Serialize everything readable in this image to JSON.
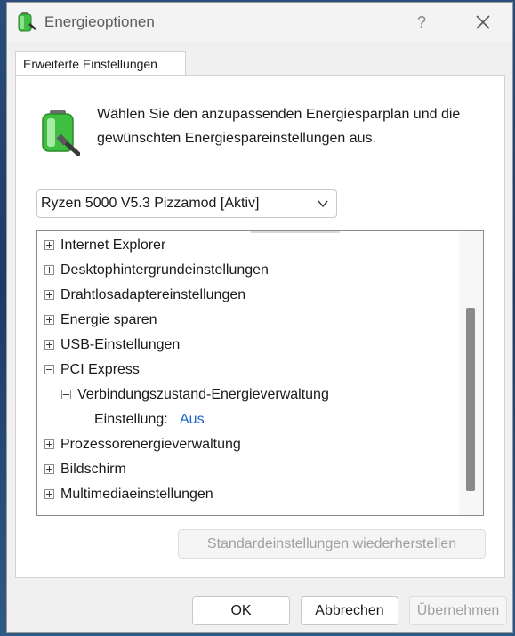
{
  "window": {
    "title": "Energieoptionen",
    "help_glyph": "?",
    "close_icon": "close-icon"
  },
  "tab": {
    "label": "Erweiterte Einstellungen"
  },
  "description": "Wählen Sie den anzupassenden Energiesparplan und die gewünschten Energiespareinstellungen aus.",
  "plan_select": {
    "value": "Ryzen 5000 V5.3 Pizzamod [Aktiv]"
  },
  "tree": {
    "items": [
      {
        "label": "Internet Explorer",
        "expanded": false
      },
      {
        "label": "Desktophintergrundeinstellungen",
        "expanded": false
      },
      {
        "label": "Drahtlosadaptereinstellungen",
        "expanded": false
      },
      {
        "label": "Energie sparen",
        "expanded": false
      },
      {
        "label": "USB-Einstellungen",
        "expanded": false
      },
      {
        "label": "PCI Express",
        "expanded": true
      },
      {
        "label": "Verbindungszustand-Energieverwaltung",
        "expanded": true
      },
      {
        "label": "Einstellung:",
        "value": "Aus"
      },
      {
        "label": "Prozessorenergieverwaltung",
        "expanded": false
      },
      {
        "label": "Bildschirm",
        "expanded": false
      },
      {
        "label": "Multimediaeinstellungen",
        "expanded": false
      }
    ]
  },
  "buttons": {
    "restore": "Standardeinstellungen wiederherstellen",
    "ok": "OK",
    "cancel": "Abbrechen",
    "apply": "Übernehmen"
  },
  "colors": {
    "setting_value": "#1a64c8",
    "battery_green": "#3fbf3f"
  }
}
